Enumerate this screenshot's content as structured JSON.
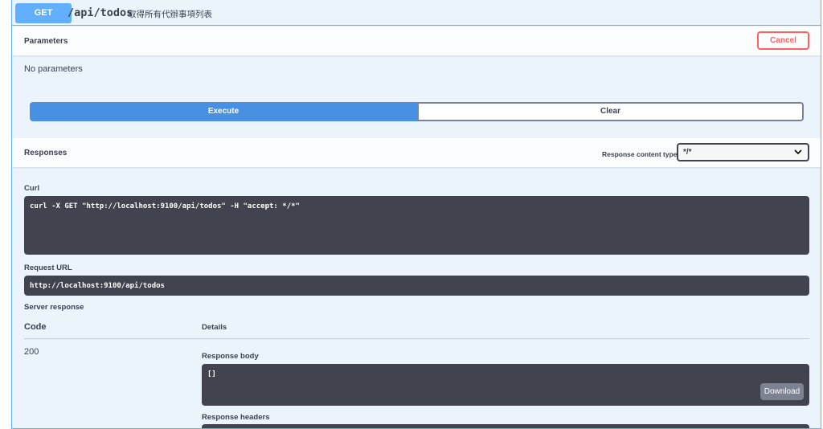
{
  "operation": {
    "method": "GET",
    "path": "/api/todos",
    "summary": "取得所有代辦事項列表",
    "method_color": "#61affe"
  },
  "parameters": {
    "title": "Parameters",
    "cancel_label": "Cancel",
    "empty_text": "No parameters"
  },
  "actions": {
    "execute_label": "Execute",
    "clear_label": "Clear"
  },
  "responses": {
    "title": "Responses",
    "content_type_label": "Response content type",
    "content_type_value": "*/*"
  },
  "curl": {
    "label": "Curl",
    "command": "curl -X GET \"http://localhost:9100/api/todos\" -H \"accept: */*\""
  },
  "request_url": {
    "label": "Request URL",
    "value": "http://localhost:9100/api/todos"
  },
  "server_response": {
    "title": "Server response",
    "code_header": "Code",
    "details_header": "Details",
    "code": "200",
    "body_label": "Response body",
    "body": "[]",
    "download_label": "Download",
    "headers_label": "Response headers"
  }
}
